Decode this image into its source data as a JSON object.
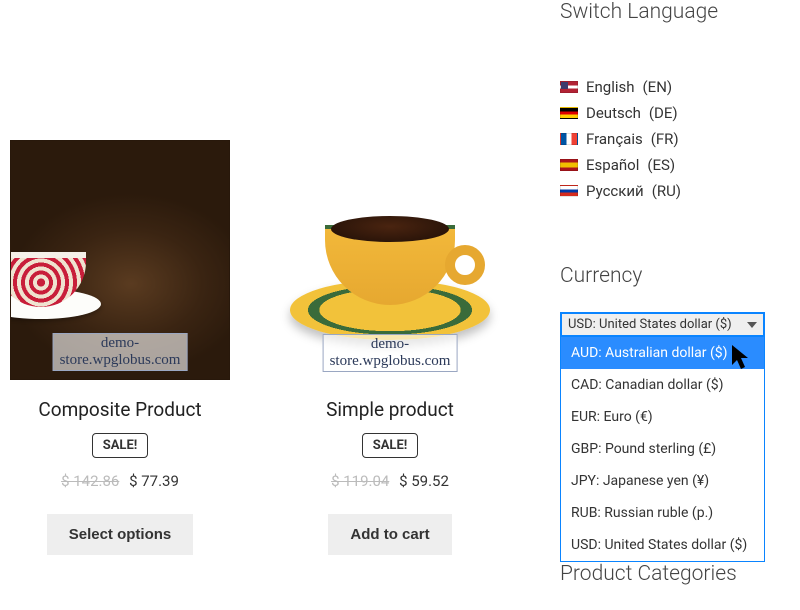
{
  "sidebar": {
    "switch_language_title": "Switch Language",
    "languages": [
      {
        "label": "English",
        "code": "(EN)",
        "flag": "flag-us"
      },
      {
        "label": "Deutsch",
        "code": "(DE)",
        "flag": "flag-de"
      },
      {
        "label": "Français",
        "code": "(FR)",
        "flag": "flag-fr"
      },
      {
        "label": "Español",
        "code": "(ES)",
        "flag": "flag-es"
      },
      {
        "label": "Русский",
        "code": "(RU)",
        "flag": "flag-ru"
      }
    ],
    "currency_title": "Currency",
    "currency_selected": "USD: United States dollar ($)",
    "currency_options": [
      {
        "label": "AUD: Australian dollar ($)",
        "highlight": true
      },
      {
        "label": "CAD: Canadian dollar ($)"
      },
      {
        "label": "EUR: Euro (€)"
      },
      {
        "label": "GBP: Pound sterling (£)"
      },
      {
        "label": "JPY: Japanese yen (¥)"
      },
      {
        "label": "RUB: Russian ruble (р.)"
      },
      {
        "label": "USD: United States dollar ($)"
      }
    ],
    "categories_title": "Product Categories"
  },
  "products": [
    {
      "watermark": "demo-store.wpglobus.com",
      "title": "Composite Product",
      "sale": "SALE!",
      "old_price": "$ 142.86",
      "new_price": "$ 77.39",
      "button": "Select options"
    },
    {
      "watermark": "demo-store.wpglobus.com",
      "title": "Simple product",
      "sale": "SALE!",
      "old_price": "$ 119.04",
      "new_price": "$ 59.52",
      "button": "Add to cart"
    }
  ]
}
